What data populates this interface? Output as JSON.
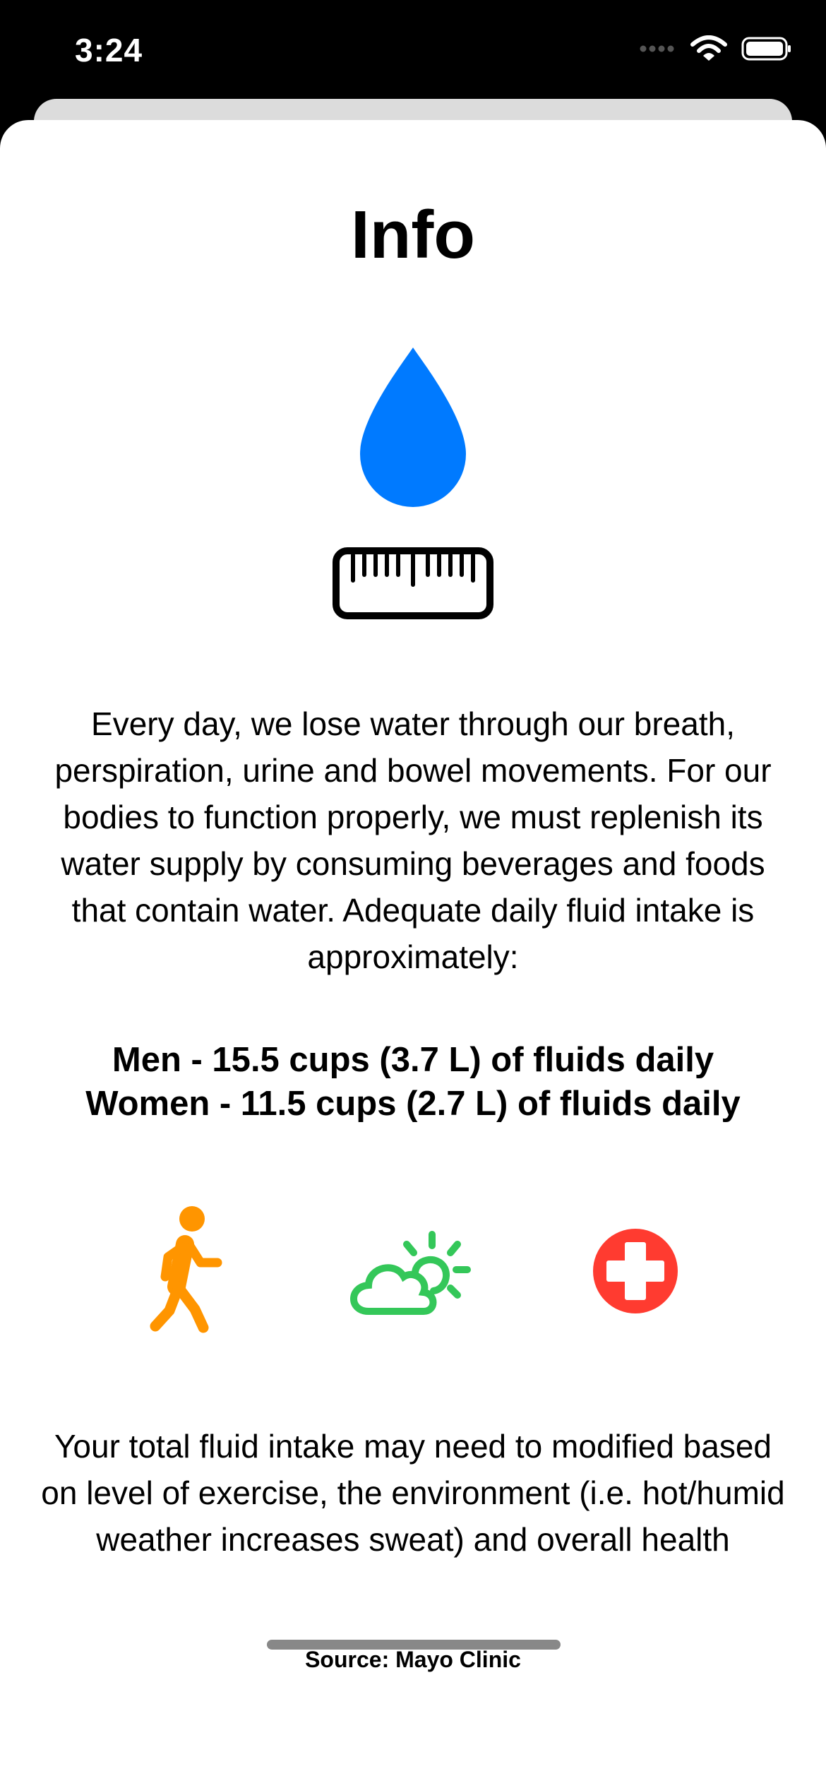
{
  "status_bar": {
    "time": "3:24"
  },
  "sheet": {
    "title": "Info",
    "intro_paragraph": "Every day, we lose water through our breath, perspiration, urine and bowel movements. For our bodies to function properly, we must replenish its water supply by consuming beverages and foods that contain water. Adequate daily fluid intake is approximately:",
    "intake": {
      "men": "Men - 15.5 cups (3.7 L) of fluids daily",
      "women": "Women - 11.5 cups (2.7 L) of fluids daily"
    },
    "factor_icons": [
      {
        "icon": "walking-figure-icon",
        "color": "#FF9500"
      },
      {
        "icon": "sun-behind-cloud-icon",
        "color": "#34C759"
      },
      {
        "icon": "medical-cross-icon",
        "color": "#FF3B30"
      }
    ],
    "modifier_paragraph": "Your total fluid intake may need to modified based on level of exercise, the environment (i.e. hot/humid weather increases sweat) and overall health",
    "source": "Source: Mayo Clinic"
  },
  "colors": {
    "drop": "#007AFF",
    "walk": "#FF9500",
    "weather": "#34C759",
    "health": "#FF3B30"
  }
}
